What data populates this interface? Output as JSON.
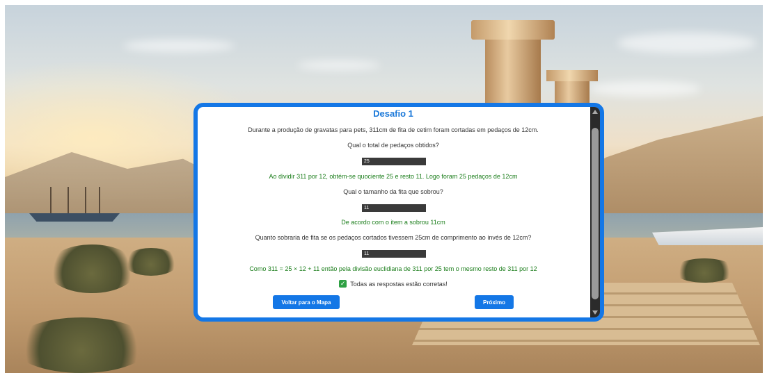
{
  "challenge": {
    "title": "Desafio 1",
    "statement": "Durante a produção de gravatas para pets, 311cm de fita de cetim foram cortadas em pedaços de 12cm.",
    "questions": [
      {
        "text": "Qual o total de pedaços obtidos?",
        "answer": "25",
        "feedback": "Ao dividir 311 por 12, obtém-se quociente 25 e resto 11. Logo foram 25 pedaços de 12cm"
      },
      {
        "text": "Qual o tamanho da fita que sobrou?",
        "answer": "11",
        "feedback": "De acordo com o item a sobrou 11cm"
      },
      {
        "text": "Quanto sobraria de fita se os pedaços cortados tivessem 25cm de comprimento ao invés de 12cm?",
        "answer": "11",
        "feedback": "Como 311 = 25 × 12 + 11 então pela divisão euclidiana de 311 por 25 tem o mesmo resto de 311 por 12"
      }
    ],
    "all_correct": "Todas as respostas estão corretas!",
    "check_icon": "✓",
    "buttons": {
      "back": "Voltar para o Mapa",
      "next": "Próximo"
    }
  },
  "colors": {
    "accent": "#1477e6",
    "feedback": "#1a7d1a",
    "success": "#2ea043"
  }
}
